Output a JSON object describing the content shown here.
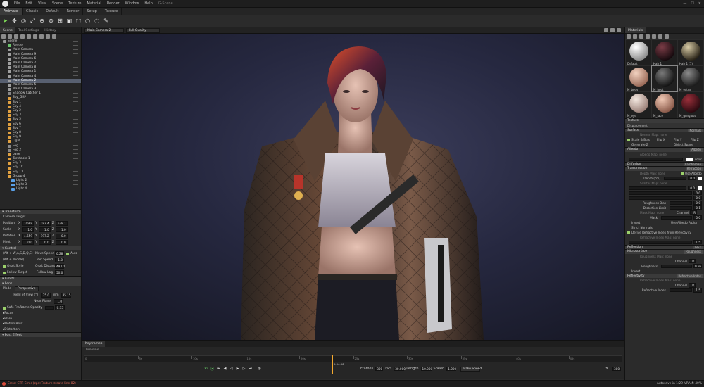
{
  "app": {
    "title": "G-Scene"
  },
  "menu": [
    "File",
    "Edit",
    "View",
    "Scene",
    "Texture",
    "Material",
    "Render",
    "Window",
    "Help"
  ],
  "modes": [
    "Animate",
    "Classic",
    "Default",
    "Render",
    "Setup",
    "Texture",
    "+"
  ],
  "left": {
    "tabs": [
      "Scene",
      "Tool Settings",
      "History"
    ],
    "tree": [
      {
        "label": "Scene",
        "icon": "scene",
        "sel": false
      },
      {
        "label": "Render",
        "icon": "green",
        "sel": false
      },
      {
        "label": "Main Camera",
        "icon": "cam",
        "sel": false
      },
      {
        "label": "Main Camera 9",
        "icon": "cam",
        "sel": false
      },
      {
        "label": "Main Camera 6",
        "icon": "cam",
        "sel": false
      },
      {
        "label": "Main Camera 7",
        "icon": "cam",
        "sel": false
      },
      {
        "label": "Main Camera 8",
        "icon": "cam",
        "sel": false
      },
      {
        "label": "Main Camera 1",
        "icon": "cam",
        "sel": false
      },
      {
        "label": "Main Camera 4",
        "icon": "cam",
        "sel": false
      },
      {
        "label": "Main Camera 2",
        "icon": "cam",
        "sel": true
      },
      {
        "label": "Main Camera 5",
        "icon": "cam",
        "sel": false
      },
      {
        "label": "Main Camera 3",
        "icon": "cam",
        "sel": false
      },
      {
        "label": "Shadow Catcher 1",
        "icon": "gray",
        "sel": false
      },
      {
        "label": "Sky_GRP",
        "icon": "sky",
        "sel": false
      },
      {
        "label": "Sky 1",
        "icon": "sky",
        "sel": false
      },
      {
        "label": "Sky 4",
        "icon": "sky",
        "sel": false
      },
      {
        "label": "Sky 2",
        "icon": "sky",
        "sel": false
      },
      {
        "label": "Sky 3",
        "icon": "sky",
        "sel": false
      },
      {
        "label": "Sky 5",
        "icon": "sky",
        "sel": false
      },
      {
        "label": "Sky 6",
        "icon": "sky",
        "sel": false
      },
      {
        "label": "Sky 7",
        "icon": "sky",
        "sel": false
      },
      {
        "label": "Sky 8",
        "icon": "sky",
        "sel": false
      },
      {
        "label": "Sky 9",
        "icon": "sky",
        "sel": false
      },
      {
        "label": "Light",
        "icon": "sky",
        "sel": false
      },
      {
        "label": "Fog 1",
        "icon": "gray",
        "sel": false
      },
      {
        "label": "Fog 2",
        "icon": "gray",
        "sel": false
      },
      {
        "label": "base",
        "icon": "sky",
        "sel": false
      },
      {
        "label": "Turntable 1",
        "icon": "sky",
        "sel": false
      },
      {
        "label": "Sky 3",
        "icon": "sky",
        "sel": false
      },
      {
        "label": "Sky 10",
        "icon": "sky",
        "sel": false
      },
      {
        "label": "Sky 11",
        "icon": "sky",
        "sel": false
      },
      {
        "label": "Group 4",
        "icon": "sky",
        "sel": false
      },
      {
        "label": "Light 2",
        "icon": "light",
        "sel": false
      },
      {
        "label": "Light 3",
        "icon": "light",
        "sel": false
      },
      {
        "label": "Light 4",
        "icon": "light",
        "sel": false
      }
    ],
    "transform": {
      "header": "Transform",
      "target": "Camera Target",
      "rows": [
        {
          "label": "Position",
          "vals": [
            "109.8",
            "182.4",
            "678.1"
          ]
        },
        {
          "label": "Scale",
          "vals": [
            "1.0",
            "1.0",
            "1.0"
          ]
        },
        {
          "label": "Rotation",
          "vals": [
            "4.659",
            "197.2",
            "0.0"
          ]
        },
        {
          "label": "Pivot",
          "vals": [
            "0.0",
            "0.0",
            "0.0"
          ]
        }
      ]
    },
    "axes": [
      "X",
      "Y",
      "Z"
    ],
    "control": {
      "header": "Control",
      "items": [
        {
          "a": "(Alt + W,A,S,D,Q,E)",
          "b": "Move Speed",
          "v": "0.28",
          "c": "Auto"
        },
        {
          "a": "(Alt + Middle)",
          "b": "Pan Speed",
          "v": "1.0"
        },
        {
          "a": "Orbit Style",
          "b": "Orbit Distance",
          "v": "493.0"
        },
        {
          "a": "Follow Target",
          "b": "Follow Lag",
          "v": "50.0"
        }
      ]
    },
    "limits": "Limits",
    "lens": {
      "header": "Lens",
      "mode_label": "Mode",
      "mode": "Perspective",
      "fov_label": "Field of View (°)",
      "fov": "75.0",
      "mm_label": "mm",
      "mm": "35.15",
      "near_label": "Near Plane",
      "near": "1.0",
      "safe_label": "Safe Frame",
      "opacity_label": "Frame Opacity",
      "opacity": "0.75"
    },
    "subs": [
      "Focus",
      "Flare",
      "Motion Blur",
      "Distortion"
    ],
    "post": "Post Effect"
  },
  "viewport": {
    "camera": "Main Camera 2",
    "quality": "Full Quality"
  },
  "timeline": {
    "tabs": [
      "Keyframes",
      "Timeline"
    ],
    "ticks": [
      "0",
      "5s",
      "10s",
      "15s",
      "20s",
      "25s",
      "30s",
      "35s",
      "40s",
      "45s"
    ],
    "current": "0:04:06",
    "frames_label": "Frames",
    "frames": "300",
    "fps_label": "FPS",
    "fps": "30.000",
    "length_label": "Length",
    "length": "10.000",
    "speed_label": "Speed",
    "speed": "1.000",
    "bake": "Bake Speed",
    "end": "300",
    "progress": 0.46
  },
  "status": {
    "error": "Error: CTR Error (cpr::Texture:create line 82)",
    "autosave": "Autosave in 1:29",
    "vram": "VRAM: 40%"
  },
  "right": {
    "tab": "Materials",
    "materials": [
      {
        "name": "Default",
        "c1": "#ffffff",
        "c2": "#8c8c8c"
      },
      {
        "name": "Hair 1",
        "c1": "#7a3c46",
        "c2": "#160a0e"
      },
      {
        "name": "Hair 1 (1)",
        "c1": "#d6c9a4",
        "c2": "#2a2418"
      },
      {
        "name": "M_body",
        "c1": "#f2d2c0",
        "c2": "#9a6a58"
      },
      {
        "name": "M_boot",
        "c1": "#7a7a7a",
        "c2": "#141414"
      },
      {
        "name": "M_extra",
        "c1": "#8a8a8a",
        "c2": "#1c1c1c"
      },
      {
        "name": "M_eye",
        "c1": "#f4e8e0",
        "c2": "#9a8078"
      },
      {
        "name": "M_face",
        "c1": "#f0c8b4",
        "c2": "#8a5a4a"
      },
      {
        "name": "M_gungloss",
        "c1": "#9a2f3a",
        "c2": "#2a0a10"
      }
    ],
    "texture": "Texture",
    "displacement": "Displacement",
    "surface": {
      "h": "Surface",
      "r": "Normals",
      "normal": "Normal Map: none",
      "scale": "Scale & Bias",
      "fx": "Flip X",
      "fy": "Flip Y",
      "fz": "Flip Z",
      "gen": "Generate Z",
      "obj": "Object Space"
    },
    "albedo": {
      "h": "Albedo",
      "r": "Albedo",
      "map": "Albedo Map: none",
      "color": "color"
    },
    "diffusion": {
      "h": "Diffusion",
      "r": "Lambertian"
    },
    "transmission": {
      "h": "Transmission",
      "r": "Refraction",
      "depth_map": "Depth Map: none",
      "use": "Use Albedo",
      "depth": "Depth (cm)",
      "depth_v": "0.0",
      "scatter": "Scatter Map: none",
      "v1": "0.0",
      "v2": "0.0",
      "v3": "0.0",
      "rb": "Roughness Bias",
      "rb_v": "0.0",
      "dl": "Distortion Limit",
      "dl_v": "0.1",
      "mask_map": "Mask Map: none",
      "channel": "Channel",
      "ch_v": "R",
      "mask": "Mask",
      "mask_v": "0.0",
      "invert": "Invert",
      "use_alpha": "Use Albedo Alpha",
      "strict": "Strict Normals",
      "derive": "Derive Refractive Index from Reflectivity",
      "rimap": "Refractive Index Map: none",
      "ri_v": "1.5"
    },
    "reflection": {
      "h": "Reflection",
      "r": "GGX"
    },
    "micro": {
      "h": "Microsurface",
      "r": "Roughness",
      "map": "Roughness Map: none",
      "channel": "Channel",
      "ch_v": "R",
      "rough": "Roughness",
      "rough_v": "0.95",
      "invert": "Invert"
    },
    "reflectivity": {
      "h": "Reflectivity",
      "r": "Refractive Index",
      "map": "Refractive Index Map: none",
      "channel": "Channel",
      "ch_v": "R",
      "ri": "Refractive Index",
      "ri_v": "1.5"
    }
  }
}
